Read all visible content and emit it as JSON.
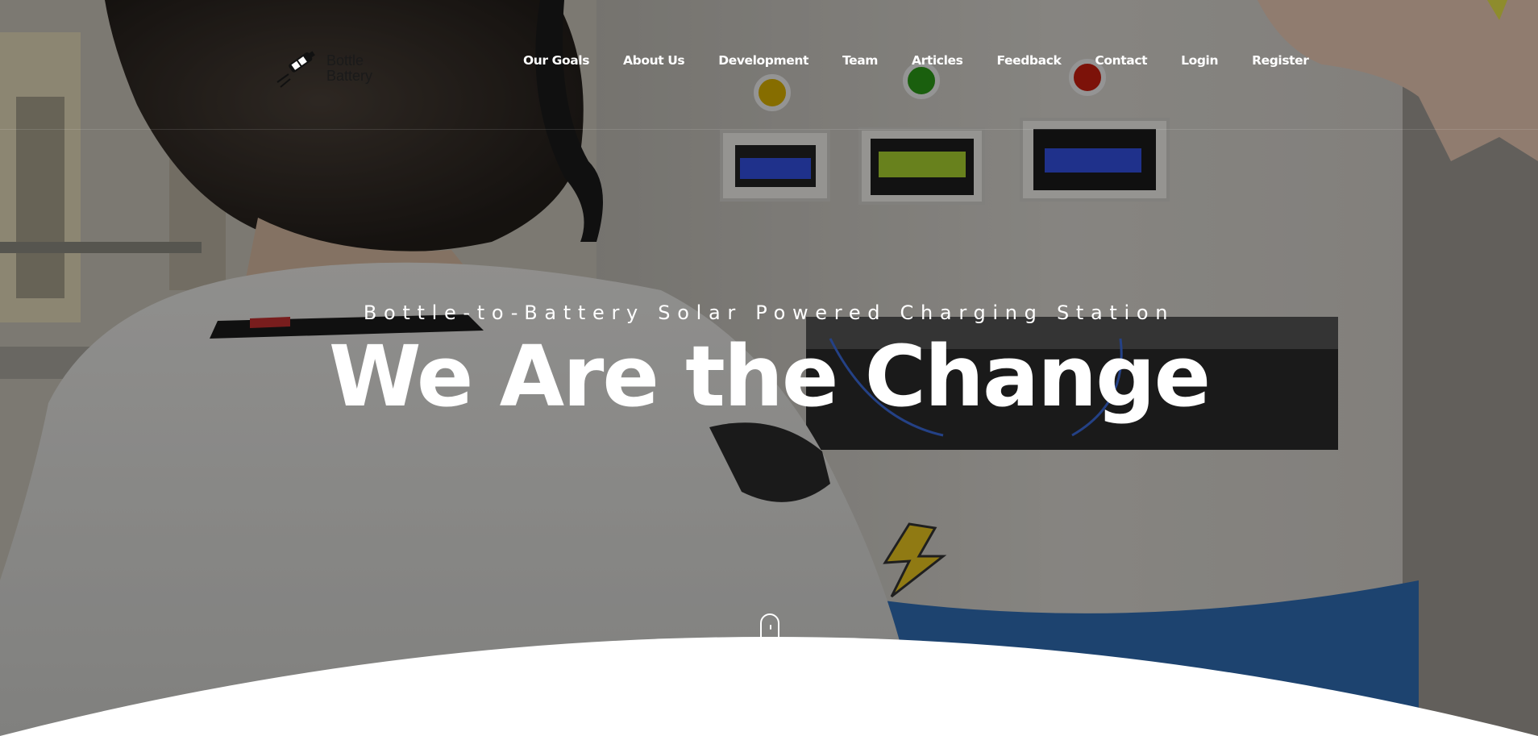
{
  "brand": {
    "name_line1": "Bottle",
    "name_line2": "Battery"
  },
  "nav": {
    "items": [
      {
        "label": "Our Goals"
      },
      {
        "label": "About Us"
      },
      {
        "label": "Development"
      },
      {
        "label": "Team"
      },
      {
        "label": "Articles"
      },
      {
        "label": "Feedback"
      },
      {
        "label": "Contact"
      },
      {
        "label": "Login"
      },
      {
        "label": "Register"
      }
    ]
  },
  "hero": {
    "tagline": "Bottle-to-Battery Solar Powered Charging Station",
    "headline": "We Are the Change"
  },
  "icons": {
    "logo": "bottle-battery-logo-icon",
    "scroll": "mouse-scroll-icon"
  },
  "colors": {
    "text": "#ffffff",
    "overlay": "#000000",
    "curve": "#ffffff",
    "button_yellow": "#d8b000",
    "button_green": "#2a9a18",
    "button_red": "#c81d10",
    "lcd_blue": "#3350e0",
    "lcd_green": "#a9d030"
  }
}
